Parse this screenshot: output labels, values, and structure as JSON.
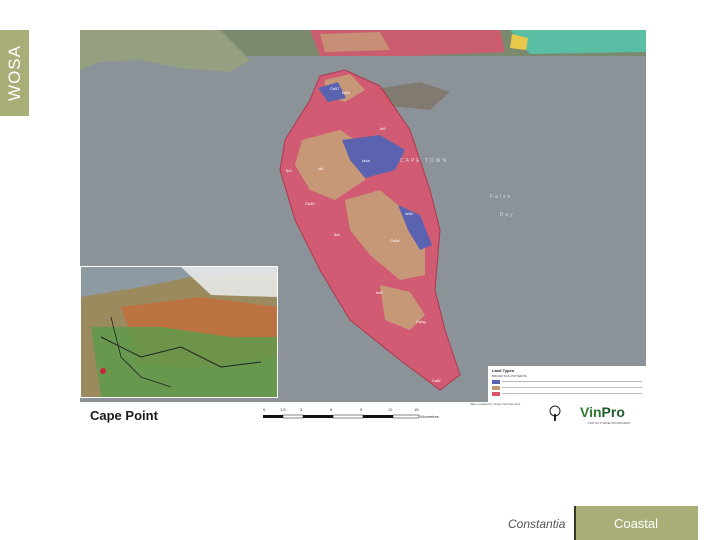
{
  "sidebar": {
    "logo_text": "WOSA"
  },
  "map": {
    "title": "Cape Point",
    "water_labels": [
      "CAPE TOWN",
      "False",
      "Bay"
    ],
    "region_labels": [
      "Ca57",
      "Ib8d",
      "Ia4a",
      "Ib6",
      "Ib9",
      "Ia5",
      "Ca30",
      "Ia5d",
      "Ib8",
      "Ca3d",
      "Ia4f",
      "Ca4g",
      "Ca5f"
    ],
    "scale_ticks": [
      "0",
      "1.5",
      "3",
      "6",
      "9",
      "12",
      "15"
    ],
    "scale_unit": "Kilometres",
    "legend_title": "Land Types",
    "legend_subtitle": "BROAD SOIL PATTERNS",
    "credits": "Map compiled by Vinpro Soil Services",
    "vinpro_left": "Vin",
    "vinpro_right": "Pro",
    "vinpro_tagline": "FOR SA'S WINE PRODUCERS"
  },
  "footer": {
    "left_label": "Constantia",
    "button_label": "Coastal"
  },
  "colors": {
    "accent": "#a9ad78",
    "water": "#8b9298",
    "pink": "#d9566e",
    "tan": "#c79878",
    "blue": "#5b63b0",
    "teal": "#55c3a8"
  }
}
